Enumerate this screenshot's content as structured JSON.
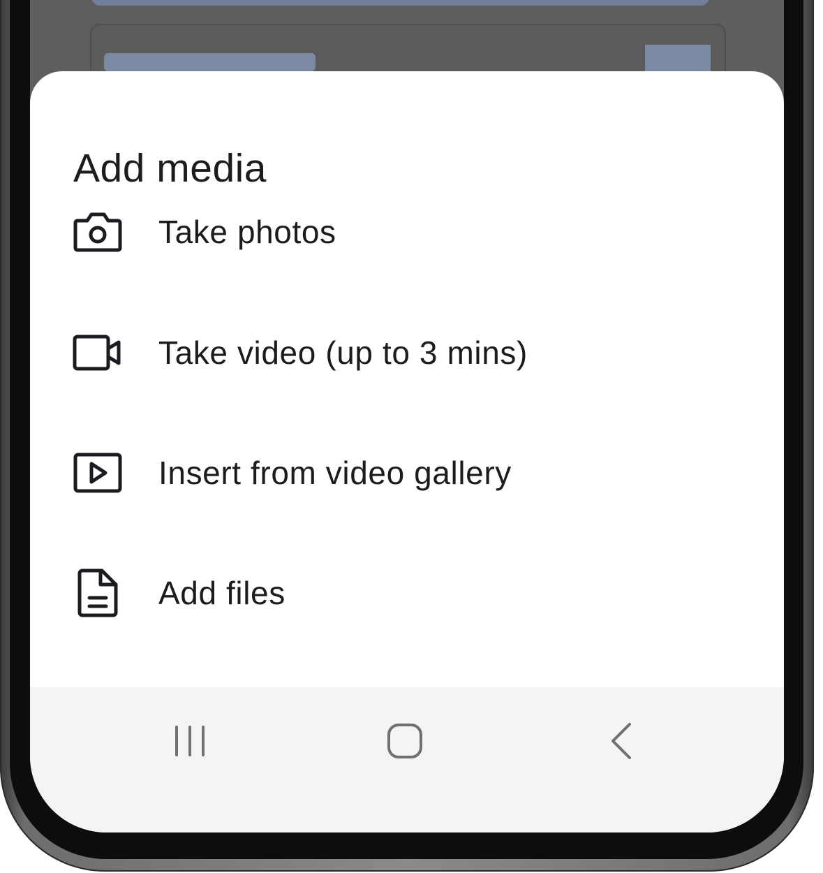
{
  "sheet": {
    "title": "Add media",
    "items": [
      {
        "label": "Take photos",
        "icon": "camera-icon"
      },
      {
        "label": "Take video (up to 3 mins)",
        "icon": "video-camera-icon"
      },
      {
        "label": "Insert from video gallery",
        "icon": "video-gallery-icon"
      },
      {
        "label": "Add files",
        "icon": "file-icon"
      }
    ]
  },
  "navbar": {
    "buttons": [
      {
        "icon": "recent-apps-icon"
      },
      {
        "icon": "home-icon"
      },
      {
        "icon": "back-icon"
      }
    ]
  },
  "colors": {
    "text": "#1c1b1f",
    "icon": "#1c1b1f",
    "navbar_bg": "#f4f4f6",
    "scrim": "#5e5e5e",
    "placeholder_accent": "#7a8aa3"
  }
}
